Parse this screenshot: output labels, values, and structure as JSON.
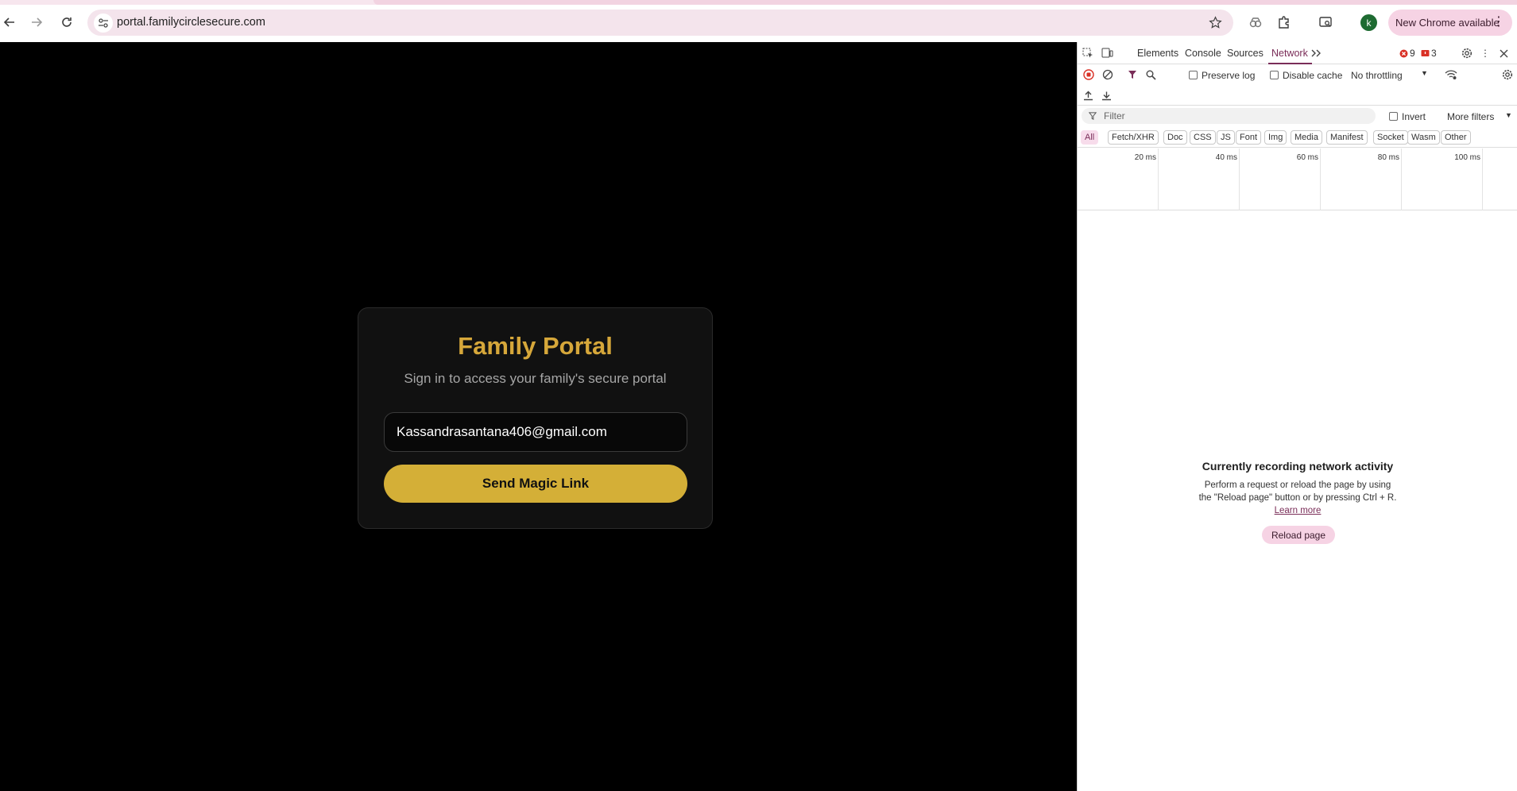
{
  "browser": {
    "url": "portal.familycirclesecure.com",
    "profile_initial": "k",
    "update_chip_label": "New Chrome available",
    "colors": {
      "accent": "#f6d3e4",
      "profile": "#1e6b32"
    }
  },
  "page": {
    "title": "Family Portal",
    "subtitle": "Sign in to access your family's secure portal",
    "email_value": "Kassandrasantana406@gmail.com",
    "submit_label": "Send Magic Link",
    "colors": {
      "gold": "#d4af37",
      "title_gold": "#d6a73a",
      "background": "#000000",
      "card": "#111111"
    }
  },
  "devtools": {
    "tabs": [
      "Elements",
      "Console",
      "Sources",
      "Network"
    ],
    "active_tab": "Network",
    "error_count": "9",
    "warning_count": "3",
    "preserve_log_label": "Preserve log",
    "disable_cache_label": "Disable cache",
    "throttling_label": "No throttling",
    "filter_placeholder": "Filter",
    "invert_label": "Invert",
    "more_filters_label": "More filters",
    "type_filters": [
      "All",
      "Fetch/XHR",
      "Doc",
      "CSS",
      "JS",
      "Font",
      "Img",
      "Media",
      "Manifest",
      "Socket",
      "Wasm",
      "Other"
    ],
    "timeline_ticks": [
      "20 ms",
      "40 ms",
      "60 ms",
      "80 ms",
      "100 ms"
    ],
    "empty_title": "Currently recording network activity",
    "empty_body": "Perform a request or reload the page by using the \"Reload page\" button or by pressing Ctrl + R.",
    "learn_more": "Learn more",
    "reload_button": "Reload page"
  }
}
